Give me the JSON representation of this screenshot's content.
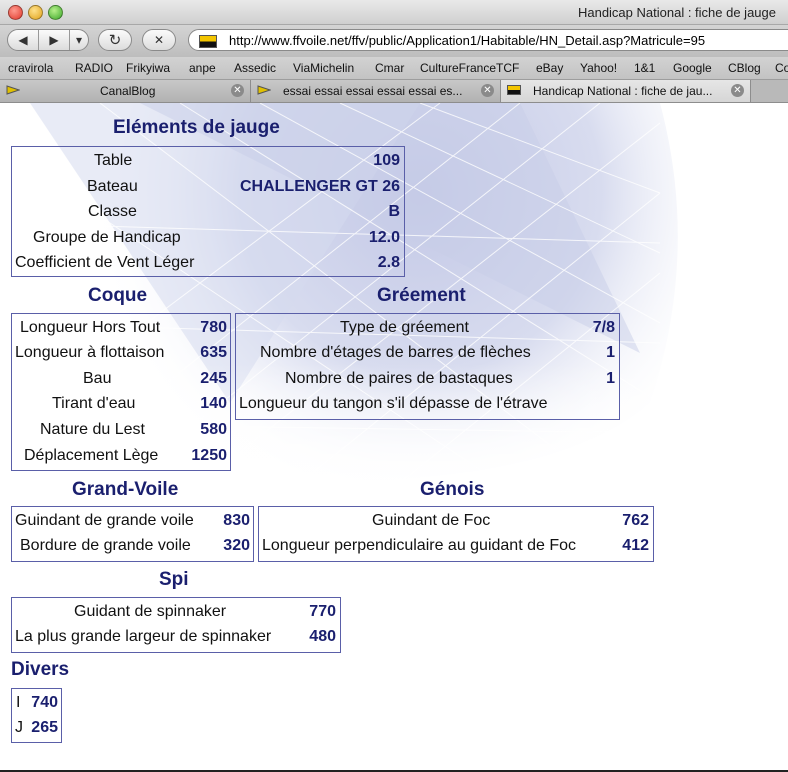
{
  "window": {
    "title": "Handicap National : fiche de jauge"
  },
  "toolbar": {
    "back_glyph": "◀",
    "forward_glyph": "▶",
    "menu_glyph": "▾",
    "reload_glyph": "↻",
    "stop_glyph": "✕",
    "url": "http://www.ffvoile.net/ffv/public/Application1/Habitable/HN_Detail.asp?Matricule=95"
  },
  "bookmarks": [
    "cravirola",
    "RADIO",
    "Frikyiwa",
    "anpe",
    "Assedic",
    "ViaMichelin",
    "Cmar",
    "CultureFranceTCF",
    "eBay",
    "Yahoo!",
    "1&1",
    "Google",
    "CBlog",
    "Co"
  ],
  "tabs": [
    {
      "label": "CanalBlog",
      "active": false
    },
    {
      "label": "essai essai essai essai essai es...",
      "active": false
    },
    {
      "label": "Handicap National : fiche de jau...",
      "active": true
    }
  ],
  "colors": {
    "heading": "#1a1f6e",
    "value": "#1a1f6e",
    "border": "#5a5fa8"
  },
  "sections": {
    "elements": {
      "title": "Eléments de jauge",
      "rows": [
        {
          "label": "Table",
          "value": "109"
        },
        {
          "label": "Bateau",
          "value": "CHALLENGER GT 26"
        },
        {
          "label": "Classe",
          "value": "B"
        },
        {
          "label": "Groupe de Handicap",
          "value": "12.0"
        },
        {
          "label": "Coefficient de Vent Léger",
          "value": "2.8"
        }
      ]
    },
    "coque": {
      "title": "Coque",
      "rows": [
        {
          "label": "Longueur Hors Tout",
          "value": "780"
        },
        {
          "label": "Longueur à flottaison",
          "value": "635"
        },
        {
          "label": "Bau",
          "value": "245"
        },
        {
          "label": "Tirant d'eau",
          "value": "140"
        },
        {
          "label": "Nature du Lest",
          "value": "580"
        },
        {
          "label": "Déplacement Lège",
          "value": "1250"
        }
      ]
    },
    "greement": {
      "title": "Gréement",
      "rows": [
        {
          "label": "Type de gréement",
          "value": "7/8"
        },
        {
          "label": "Nombre d'étages de barres de flèches",
          "value": "1"
        },
        {
          "label": "Nombre de paires de bastaques",
          "value": "1"
        },
        {
          "label": "Longueur du tangon s'il dépasse de l'étrave",
          "value": ""
        }
      ]
    },
    "grandvoile": {
      "title": "Grand-Voile",
      "rows": [
        {
          "label": "Guindant de grande voile",
          "value": "830"
        },
        {
          "label": "Bordure de grande voile",
          "value": "320"
        }
      ]
    },
    "genois": {
      "title": "Génois",
      "rows": [
        {
          "label": "Guindant de Foc",
          "value": "762"
        },
        {
          "label": "Longueur perpendiculaire au guidant de Foc",
          "value": "412"
        }
      ]
    },
    "spi": {
      "title": "Spi",
      "rows": [
        {
          "label": "Guidant de spinnaker",
          "value": "770"
        },
        {
          "label": "La plus grande largeur de spinnaker",
          "value": "480"
        }
      ]
    },
    "divers": {
      "title": "Divers",
      "rows": [
        {
          "label": "I",
          "value": "740"
        },
        {
          "label": "J",
          "value": "265"
        }
      ]
    }
  }
}
